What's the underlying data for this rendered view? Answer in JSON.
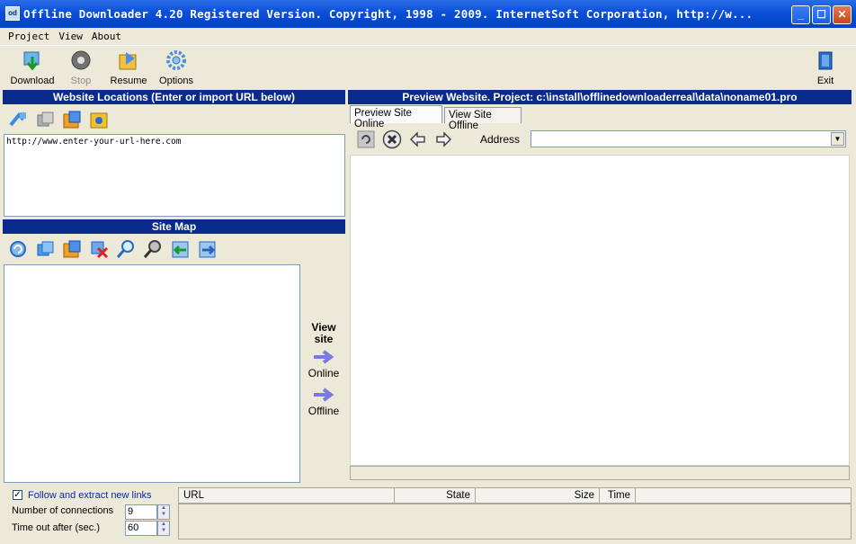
{
  "window": {
    "title": "Offline Downloader 4.20  Registered Version. Copyright, 1998 - 2009. InternetSoft Corporation, http://w..."
  },
  "menu": [
    "Project",
    "View",
    "About"
  ],
  "toolbar": {
    "download": "Download",
    "stop": "Stop",
    "resume": "Resume",
    "options": "Options",
    "exit": "Exit"
  },
  "left": {
    "locations_header": "Website Locations (Enter or import URL below)",
    "url_text": "http://www.enter-your-url-here.com",
    "sitemap_header": "Site Map",
    "view_site": "View site",
    "online": "Online",
    "offline": "Offline"
  },
  "preview": {
    "header": "Preview Website.  Project:   c:\\install\\offlinedownloaderreal\\data\\noname01.pro",
    "tab_online": "Preview Site Online",
    "tab_offline": "View Site Offline",
    "address_label": "Address",
    "address_value": ""
  },
  "bottom": {
    "follow_links": "Follow and extract new links",
    "follow_checked": true,
    "connections_label": "Number of connections",
    "connections_value": "9",
    "timeout_label": "Time out after (sec.)",
    "timeout_value": "60"
  },
  "grid": {
    "columns": [
      "URL",
      "State",
      "Size",
      "Time"
    ]
  },
  "colors": {
    "titlebar": "#0a4fd8",
    "section_header": "#0a2a8c",
    "face": "#ece9d8"
  }
}
